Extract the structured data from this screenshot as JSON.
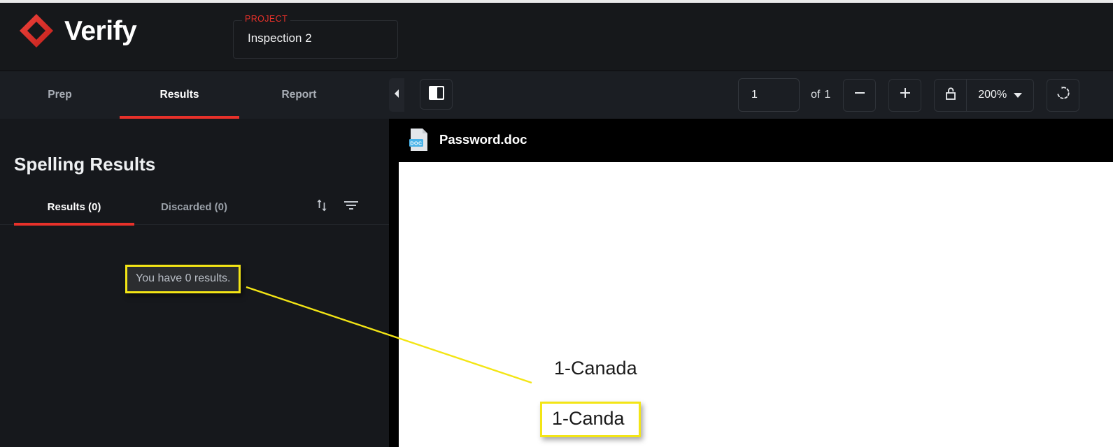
{
  "app": {
    "brand_name": "Verify",
    "logo_icon": "red-diamond-logo",
    "accent_red": "#e8312a",
    "annotation_yellow": "#f3e515"
  },
  "header": {
    "project_label": "PROJECT",
    "project_value": "Inspection 2"
  },
  "nav": {
    "tabs": [
      {
        "label": "Prep",
        "active": false
      },
      {
        "label": "Results",
        "active": true
      },
      {
        "label": "Report",
        "active": false
      }
    ],
    "collapse_icon": "chevron-left-icon",
    "panel_toggle_icon": "split-panel-icon"
  },
  "viewer_toolbar": {
    "page_value": "1",
    "page_placeholder": "1",
    "of_label": "of",
    "page_total": "1",
    "zoom_out_icon": "minus-icon",
    "zoom_in_icon": "plus-icon",
    "lock_icon": "unlock-icon",
    "zoom_level": "200%",
    "zoom_caret_icon": "chevron-down-icon",
    "rotate_icon": "rotate-icon"
  },
  "sidebar": {
    "title": "Spelling Results",
    "tabs": [
      {
        "label": "Results (0)",
        "active": true
      },
      {
        "label": "Discarded (0)",
        "active": false
      }
    ],
    "sort_icon": "sort-arrows-icon",
    "filter_icon": "filter-icon",
    "empty_message": "You have 0 results."
  },
  "document": {
    "file_icon": "doc-file-icon",
    "file_icon_badge": "DOC",
    "file_name": "Password.doc",
    "lines": [
      {
        "text": "1-Canada",
        "highlighted": false
      },
      {
        "text": "1-Canda",
        "highlighted": true
      }
    ]
  }
}
